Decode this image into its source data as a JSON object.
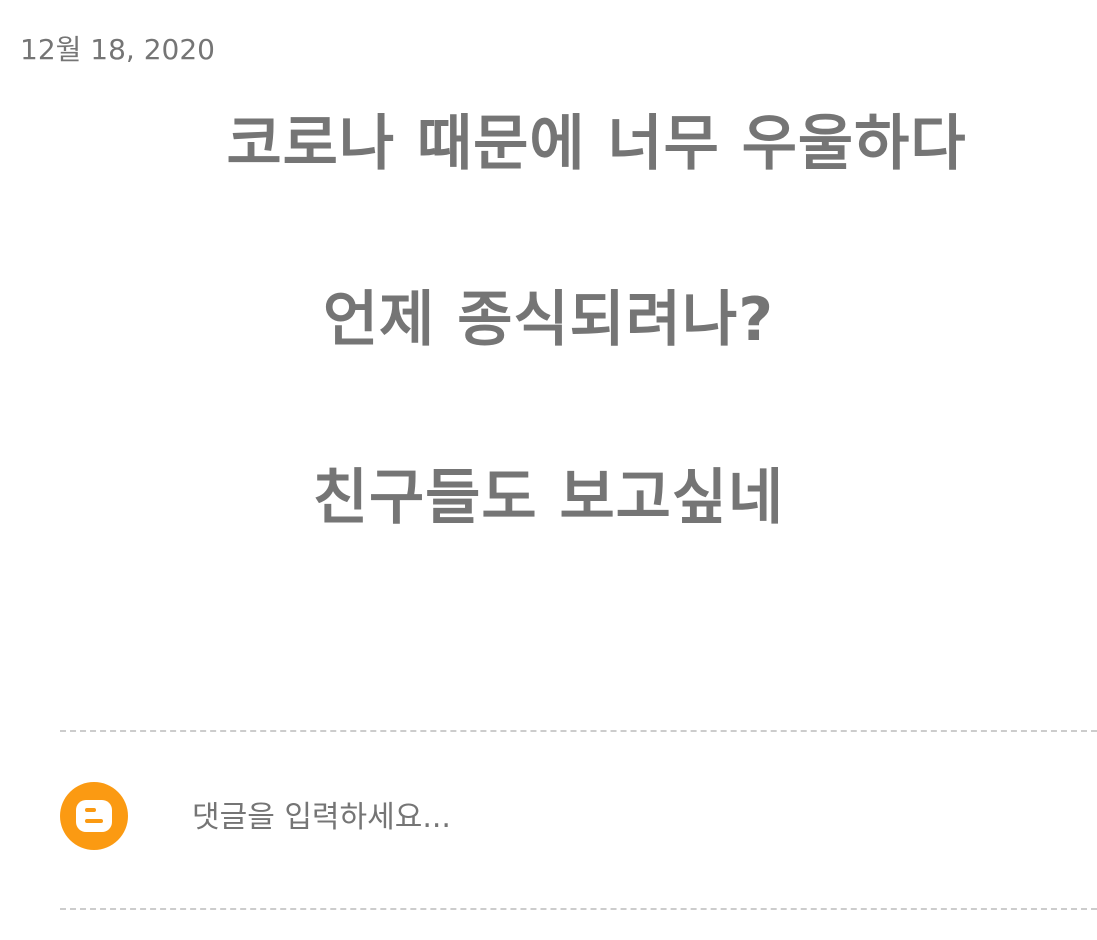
{
  "post": {
    "date": "12월 18, 2020",
    "lines": [
      "코로나 때문에 너무 우울하다",
      "언제 종식되려나?",
      "친구들도 보고싶네"
    ]
  },
  "comments": {
    "avatar_icon": "blogger-icon",
    "input_placeholder": "댓글을 입력하세요...",
    "accent_color": "#fb9a12"
  }
}
